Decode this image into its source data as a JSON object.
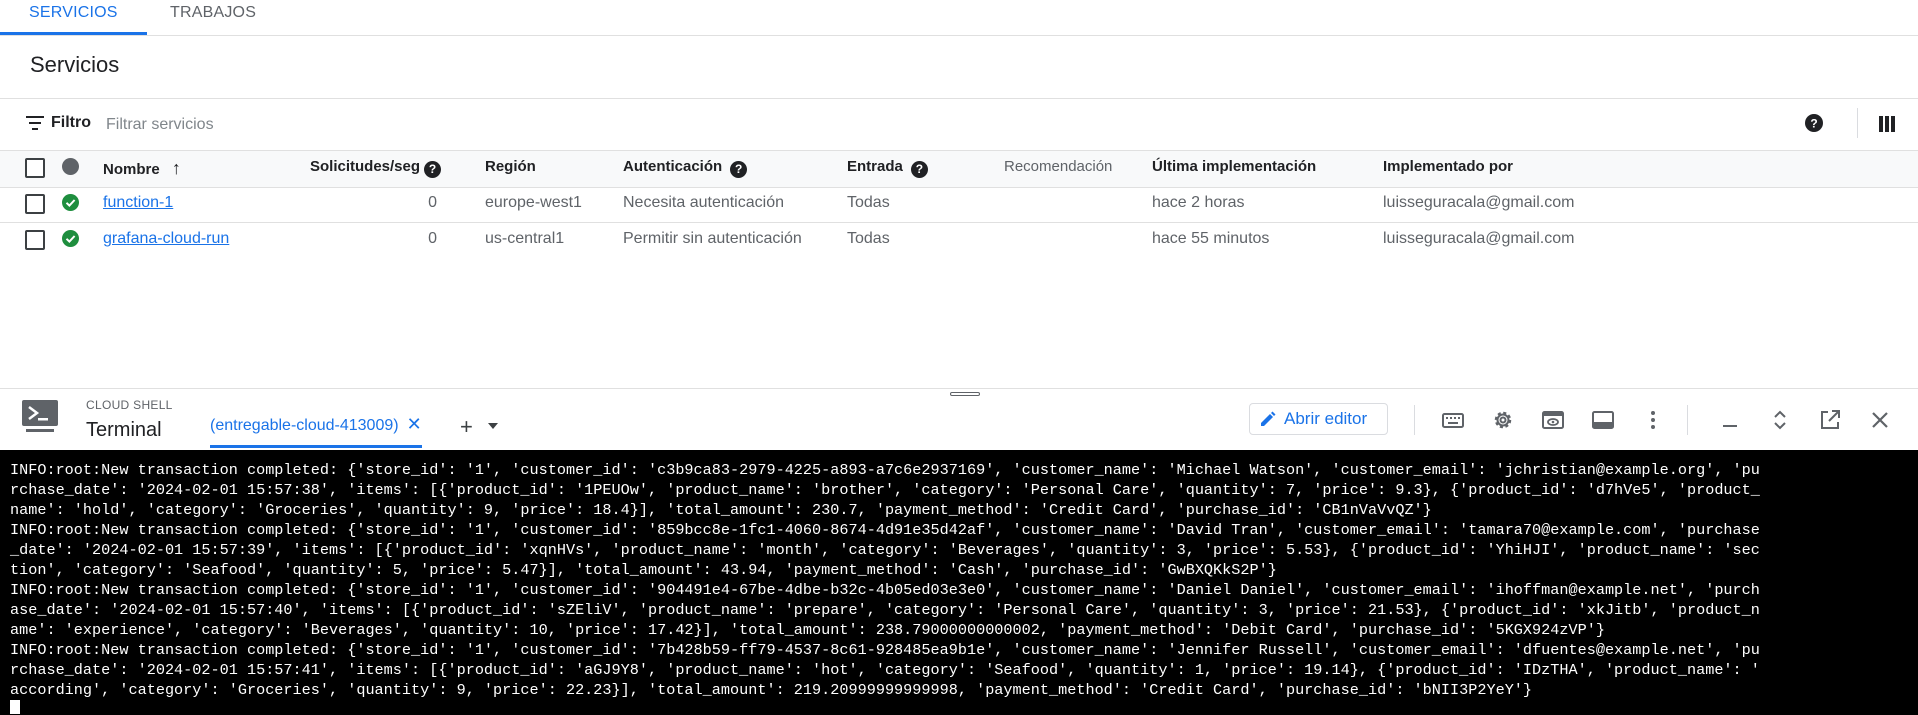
{
  "tabs": [
    {
      "label": "SERVICIOS"
    },
    {
      "label": "TRABAJOS"
    }
  ],
  "page_title": "Servicios",
  "filter": {
    "label": "Filtro",
    "placeholder": "Filtrar servicios"
  },
  "table": {
    "headers": {
      "name": "Nombre",
      "requests": "Solicitudes/seg",
      "region": "Región",
      "auth": "Autenticación",
      "ingress": "Entrada",
      "recommendation": "Recomendación",
      "last_deploy": "Última implementación",
      "deployed_by": "Implementado por"
    },
    "sort_arrow": "↑",
    "help_glyph": "?",
    "rows": [
      {
        "name": "function-1",
        "requests": "0",
        "region": "europe-west1",
        "auth": "Necesita autenticación",
        "ingress": "Todas",
        "recommendation": "",
        "last_deploy": "hace 2 horas",
        "deployed_by": "luisseguracala@gmail.com"
      },
      {
        "name": "grafana-cloud-run",
        "requests": "0",
        "region": "us-central1",
        "auth": "Permitir sin autenticación",
        "ingress": "Todas",
        "recommendation": "",
        "last_deploy": "hace 55 minutos",
        "deployed_by": "luisseguracala@gmail.com"
      }
    ]
  },
  "cloud_shell": {
    "label": "CLOUD SHELL",
    "title": "Terminal",
    "active_tab": "(entregable-cloud-413009)",
    "close_glyph": "✕",
    "add_glyph": "+",
    "open_editor": "Abrir editor",
    "terminal_lines": [
      "INFO:root:New transaction completed: {'store_id': '1', 'customer_id': 'c3b9ca83-2979-4225-a893-a7c6e2937169', 'customer_name': 'Michael Watson', 'customer_email': 'jchristian@example.org', 'pu",
      "rchase_date': '2024-02-01 15:57:38', 'items': [{'product_id': '1PEUOw', 'product_name': 'brother', 'category': 'Personal Care', 'quantity': 7, 'price': 9.3}, {'product_id': 'd7hVe5', 'product_",
      "name': 'hold', 'category': 'Groceries', 'quantity': 9, 'price': 18.4}], 'total_amount': 230.7, 'payment_method': 'Credit Card', 'purchase_id': 'CB1nVaVvQZ'}",
      "INFO:root:New transaction completed: {'store_id': '1', 'customer_id': '859bcc8e-1fc1-4060-8674-4d91e35d42af', 'customer_name': 'David Tran', 'customer_email': 'tamara70@example.com', 'purchase",
      "_date': '2024-02-01 15:57:39', 'items': [{'product_id': 'xqnHVs', 'product_name': 'month', 'category': 'Beverages', 'quantity': 3, 'price': 5.53}, {'product_id': 'YhiHJI', 'product_name': 'sec",
      "tion', 'category': 'Seafood', 'quantity': 5, 'price': 5.47}], 'total_amount': 43.94, 'payment_method': 'Cash', 'purchase_id': 'GwBXQKkS2P'}",
      "INFO:root:New transaction completed: {'store_id': '1', 'customer_id': '904491e4-67be-4dbe-b32c-4b05ed03e3e0', 'customer_name': 'Daniel Daniel', 'customer_email': 'ihoffman@example.net', 'purch",
      "ase_date': '2024-02-01 15:57:40', 'items': [{'product_id': 'sZEliV', 'product_name': 'prepare', 'category': 'Personal Care', 'quantity': 3, 'price': 21.53}, {'product_id': 'xkJitb', 'product_n",
      "ame': 'experience', 'category': 'Beverages', 'quantity': 10, 'price': 17.42}], 'total_amount': 238.79000000000002, 'payment_method': 'Debit Card', 'purchase_id': '5KGX924zVP'}",
      "INFO:root:New transaction completed: {'store_id': '1', 'customer_id': '7b428b59-ff79-4537-8c61-928485ea9b1e', 'customer_name': 'Jennifer Russell', 'customer_email': 'dfuentes@example.net', 'pu",
      "rchase_date': '2024-02-01 15:57:41', 'items': [{'product_id': 'aGJ9Y8', 'product_name': 'hot', 'category': 'Seafood', 'quantity': 1, 'price': 19.14}, {'product_id': 'IDzTHA', 'product_name': '",
      "according', 'category': 'Groceries', 'quantity': 9, 'price': 22.23}], 'total_amount': 219.20999999999998, 'payment_method': 'Credit Card', 'purchase_id': 'bNII3P2YeY'}"
    ]
  },
  "colors": {
    "accent": "#1a73e8",
    "success": "#1e8e3e",
    "terminal_bg": "#000000"
  },
  "icons": [
    "filter-icon",
    "help-icon",
    "columns-icon",
    "sort-up-icon",
    "check-circle-icon",
    "terminal-icon",
    "pencil-icon",
    "keyboard-icon",
    "gear-icon",
    "web-preview-icon",
    "layout-icon",
    "more-vert-icon",
    "minimize-icon",
    "restore-icon",
    "open-new-window-icon",
    "close-icon"
  ]
}
